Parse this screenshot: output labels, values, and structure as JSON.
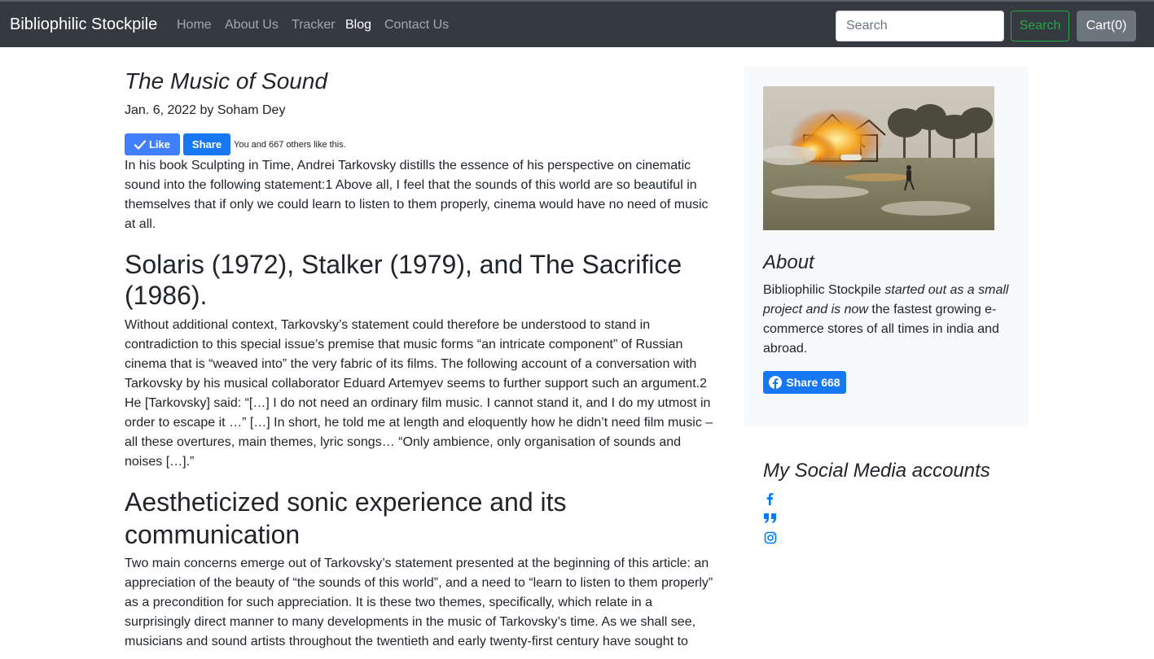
{
  "navbar": {
    "brand": "Bibliophilic Stockpile",
    "links": [
      {
        "label": "Home"
      },
      {
        "label": "About Us"
      },
      {
        "label": "Tracker"
      },
      {
        "label": "Blog",
        "active": true
      },
      {
        "label": "Contact Us"
      }
    ],
    "search_placeholder": "Search",
    "search_button": "Search",
    "cart_label": "Cart(0)"
  },
  "post": {
    "title": "The Music of Sound",
    "meta": "Jan. 6, 2022 by Soham Dey",
    "like_button": "Like",
    "share_button": "Share",
    "like_text": "You and 667 others like this.",
    "intro": "In his book Sculpting in Time, Andrei Tarkovsky distills the essence of his perspective on cinematic sound into the following statement:1 Above all, I feel that the sounds of this world are so beautiful in themselves that if only we could learn to listen to them properly, cinema would have no need of music at all.",
    "heading1": "Solaris (1972), Stalker (1979), and The Sacrifice (1986).",
    "para1": "Without additional context, Tarkovsky’s statement could therefore be understood to stand in contradiction to this special issue’s premise that music forms “an intricate component” of Russian cinema that is “weaved into” the very fabric of its films. The following account of a conversation with Tarkovsky by his musical collaborator Eduard Artemyev seems to further support such an argument.2 He [Tarkovsky] said: “[…] I do not need an ordinary film music. I cannot stand it, and I do my utmost in order to escape it …” […] In short, he told me at length and eloquently how he didn’t need film music – all these overtures, main themes, lyric songs… “Only ambience, only organisation of sounds and noises […].”",
    "heading2": "Aestheticized sonic experience and its communication",
    "para2": "Two main concerns emerge out of Tarkovsky’s statement presented at the beginning of this article: an appreciation of the beauty of “the sounds of this world”, and a need to “learn to listen to them properly” as a precondition for such appreciation. It is these two themes, specifically, which relate in a surprisingly direct manner to many developments in the music of Tarkovsky’s time. As we shall see, musicians and sound artists throughout the twentieth and early twenty-first century have sought to"
  },
  "sidebar": {
    "about_heading": "About",
    "about_parts": [
      "Bibliophilic Stockpile",
      " started out as a small project and is now",
      " the fastest growing e-commerce stores of all times in india and abroad."
    ],
    "share_label": "Share 668",
    "social_heading": "My Social Media accounts",
    "social_icons": [
      "facebook-icon",
      "quote-icon",
      "instagram-icon"
    ]
  },
  "colors": {
    "navbar_bg": "#343a40",
    "facebook_blue": "#1877f2",
    "like_blue": "#4080ff",
    "search_green": "#28a745",
    "cart_gray": "#6c757d",
    "link_blue": "#007bff"
  }
}
